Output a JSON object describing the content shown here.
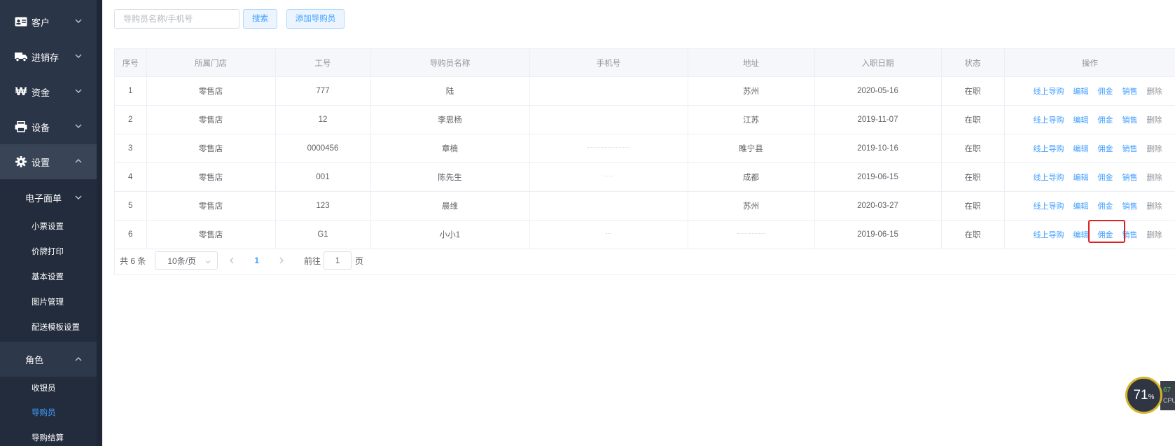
{
  "sidebar": {
    "menus": [
      {
        "label": "客户",
        "icon": "id-card-icon"
      },
      {
        "label": "进销存",
        "icon": "truck-icon"
      },
      {
        "label": "资金",
        "icon": "won-icon"
      },
      {
        "label": "设备",
        "icon": "printer-icon"
      },
      {
        "label": "设置",
        "icon": "gear-icon"
      }
    ],
    "settings_groups": {
      "electronic_form": "电子面单",
      "role": "角色"
    },
    "settings_items": [
      "小票设置",
      "价牌打印",
      "基本设置",
      "图片管理",
      "配送模板设置"
    ],
    "role_items": [
      "收银员",
      "导购员",
      "导购结算"
    ]
  },
  "toolbar": {
    "search_placeholder": "导购员名称/手机号",
    "search_label": "搜索",
    "add_label": "添加导购员"
  },
  "table": {
    "headers": [
      "序号",
      "所属门店",
      "工号",
      "导购员名称",
      "手机号",
      "地址",
      "入职日期",
      "状态",
      "操作"
    ],
    "actions": [
      "线上导购",
      "编辑",
      "佣金",
      "销售",
      "删除"
    ],
    "rows": [
      {
        "no": "1",
        "store": "零售店",
        "emp_id": "777",
        "name": "陆",
        "address": "苏州",
        "date": "2020-05-16",
        "status": "在职"
      },
      {
        "no": "2",
        "store": "零售店",
        "emp_id": "12",
        "name": "李思杨",
        "address": "江苏",
        "date": "2019-11-07",
        "status": "在职"
      },
      {
        "no": "3",
        "store": "零售店",
        "emp_id": "0000456",
        "name": "章楠",
        "address": "睢宁县",
        "date": "2019-10-16",
        "status": "在职"
      },
      {
        "no": "4",
        "store": "零售店",
        "emp_id": "001",
        "name": "陈先生",
        "address": "成都",
        "date": "2019-06-15",
        "status": "在职"
      },
      {
        "no": "5",
        "store": "零售店",
        "emp_id": "123",
        "name": "晨维",
        "address": "苏州",
        "date": "2020-03-27",
        "status": "在职"
      },
      {
        "no": "6",
        "store": "零售店",
        "emp_id": "G1",
        "name": "小小1",
        "address": "",
        "date": "2019-06-15",
        "status": "在职"
      }
    ]
  },
  "pagination": {
    "total": "共 6 条",
    "page_size": "10条/页",
    "current_page": "1",
    "goto_label": "前往",
    "goto_value": "1",
    "page_unit": "页"
  },
  "cpu_widget": {
    "value": "71",
    "unit": "%",
    "side_value": "67",
    "side_label": "CPU"
  },
  "colors": {
    "sidebar_bg": "#2b3548",
    "accent": "#409eff",
    "highlight": "#e02020"
  }
}
